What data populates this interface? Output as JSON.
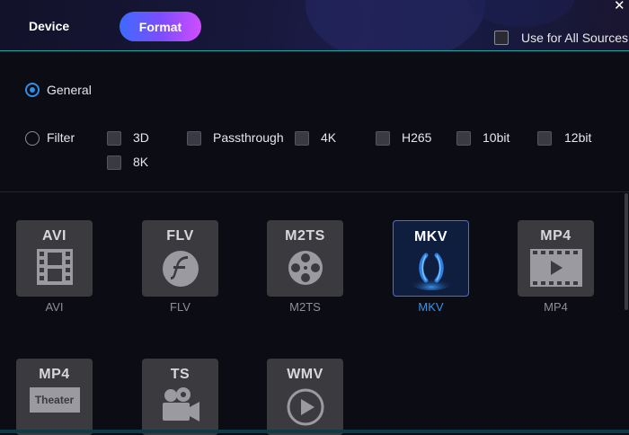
{
  "header": {
    "tabs": [
      {
        "label": "Device",
        "active": false
      },
      {
        "label": "Format",
        "active": true
      }
    ],
    "use_for_all_sources": {
      "label": "Use for All Sources",
      "checked": false
    },
    "close_glyph": "✕"
  },
  "mode": {
    "general": {
      "label": "General",
      "selected": true
    },
    "filter": {
      "label": "Filter",
      "selected": false
    }
  },
  "filters": [
    {
      "label": "3D",
      "checked": false
    },
    {
      "label": "Passthrough",
      "checked": false
    },
    {
      "label": "4K",
      "checked": false
    },
    {
      "label": "H265",
      "checked": false
    },
    {
      "label": "10bit",
      "checked": false
    },
    {
      "label": "12bit",
      "checked": false
    },
    {
      "label": "8K",
      "checked": false
    }
  ],
  "formats": [
    {
      "title": "AVI",
      "label": "AVI",
      "icon": "film-strip-icon",
      "selected": false
    },
    {
      "title": "FLV",
      "label": "FLV",
      "icon": "flash-icon",
      "selected": false
    },
    {
      "title": "M2TS",
      "label": "M2TS",
      "icon": "film-reel-icon",
      "selected": false
    },
    {
      "title": "MKV",
      "label": "MKV",
      "icon": "mkv-logo-icon",
      "selected": true
    },
    {
      "title": "MP4",
      "label": "MP4",
      "icon": "video-play-icon",
      "selected": false
    },
    {
      "title": "MP4",
      "label": "",
      "icon": "theater-icon",
      "badge": "Theater",
      "selected": false
    },
    {
      "title": "TS",
      "label": "",
      "icon": "video-camera-icon",
      "selected": false
    },
    {
      "title": "WMV",
      "label": "",
      "icon": "play-circle-icon",
      "selected": false
    }
  ],
  "colors": {
    "accent": "#2f8fe6",
    "selected_label": "#3b93e8",
    "header_rule": "#1fa7a7",
    "format_tab_gradient": [
      "#3d6bff",
      "#7b4dff",
      "#d04dff"
    ]
  }
}
